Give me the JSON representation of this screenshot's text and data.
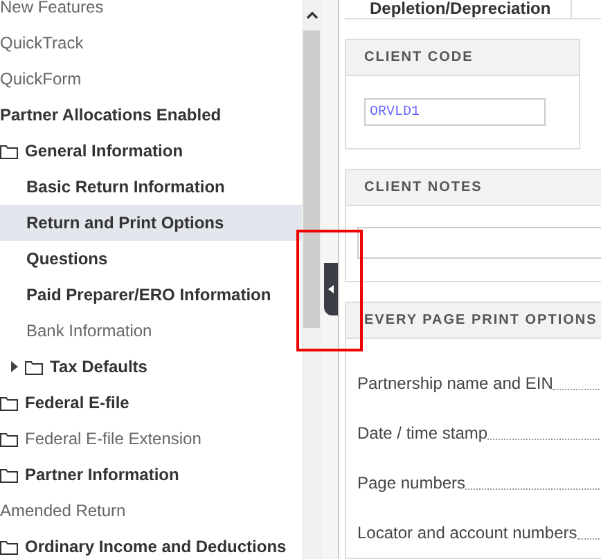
{
  "sidebar": {
    "items": [
      {
        "label": "New Features",
        "bold": false,
        "folder": false,
        "selected": false
      },
      {
        "label": "QuickTrack",
        "bold": false,
        "folder": false,
        "selected": false
      },
      {
        "label": "QuickForm",
        "bold": false,
        "folder": false,
        "selected": false
      },
      {
        "label": "Partner Allocations Enabled",
        "bold": true,
        "folder": false,
        "selected": false
      },
      {
        "label": "General Information",
        "bold": true,
        "folder": true,
        "selected": false,
        "expanded": true,
        "children": [
          {
            "label": "Basic Return Information",
            "bold": true,
            "folder": false,
            "selected": false
          },
          {
            "label": "Return and Print Options",
            "bold": true,
            "folder": false,
            "selected": true
          },
          {
            "label": "Questions",
            "bold": true,
            "folder": false,
            "selected": false
          },
          {
            "label": "Paid Preparer/ERO Information",
            "bold": true,
            "folder": false,
            "selected": false
          },
          {
            "label": "Bank Information",
            "bold": false,
            "folder": false,
            "selected": false
          },
          {
            "label": "Tax Defaults",
            "bold": true,
            "folder": true,
            "selected": false,
            "expanded": false
          }
        ]
      },
      {
        "label": "Federal E-file",
        "bold": true,
        "folder": true,
        "selected": false
      },
      {
        "label": "Federal E-file Extension",
        "bold": false,
        "folder": true,
        "selected": false
      },
      {
        "label": "Partner Information",
        "bold": true,
        "folder": true,
        "selected": false
      },
      {
        "label": "Amended Return",
        "bold": false,
        "folder": false,
        "selected": false
      },
      {
        "label": "Ordinary Income and Deductions",
        "bold": true,
        "folder": true,
        "selected": false
      }
    ]
  },
  "tabs": [
    {
      "label": "Depletion/Depreciation"
    }
  ],
  "client_code": {
    "title": "CLIENT CODE",
    "value": "ORVLD1"
  },
  "client_notes": {
    "title": "CLIENT NOTES"
  },
  "print_options": {
    "title": "EVERY PAGE PRINT OPTIONS",
    "rows": [
      {
        "label": "Partnership name and EIN"
      },
      {
        "label": "Date / time stamp"
      },
      {
        "label": "Page numbers"
      },
      {
        "label": "Locator and account numbers"
      }
    ]
  }
}
